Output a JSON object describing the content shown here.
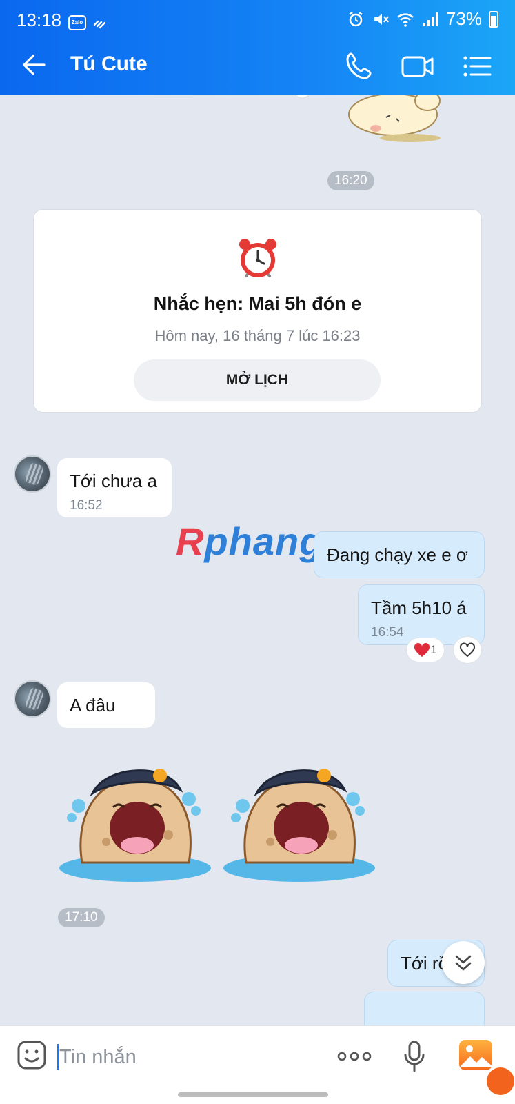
{
  "status_bar": {
    "time": "13:18",
    "app_badge": "Zalo",
    "battery": "73%"
  },
  "header": {
    "title": "Tú Cute"
  },
  "messages": {
    "time_1620": "16:20",
    "reminder": {
      "title": "Nhắc hẹn: Mai 5h đón e",
      "subtitle": "Hôm nay, 16 tháng 7 lúc 16:23",
      "button": "MỞ LỊCH"
    },
    "m1": {
      "text": "Tới chưa a",
      "time": "16:52"
    },
    "m2": {
      "text": "Đang chạy xe e ơ"
    },
    "m3": {
      "text": "Tầm 5h10 á",
      "time": "16:54",
      "reaction_count": "1"
    },
    "m4": {
      "text": "A đâu"
    },
    "time_1710": "17:10",
    "m5": {
      "text": "Tới rồ"
    }
  },
  "watermark": {
    "r": "R",
    "rest": "phang"
  },
  "input": {
    "placeholder": "Tin nhắn"
  },
  "colors": {
    "header_start": "#0a68ef",
    "header_end": "#1ba6f7",
    "outgoing_bubble": "#d6ecfd",
    "chat_bg": "#e3e7ef"
  }
}
